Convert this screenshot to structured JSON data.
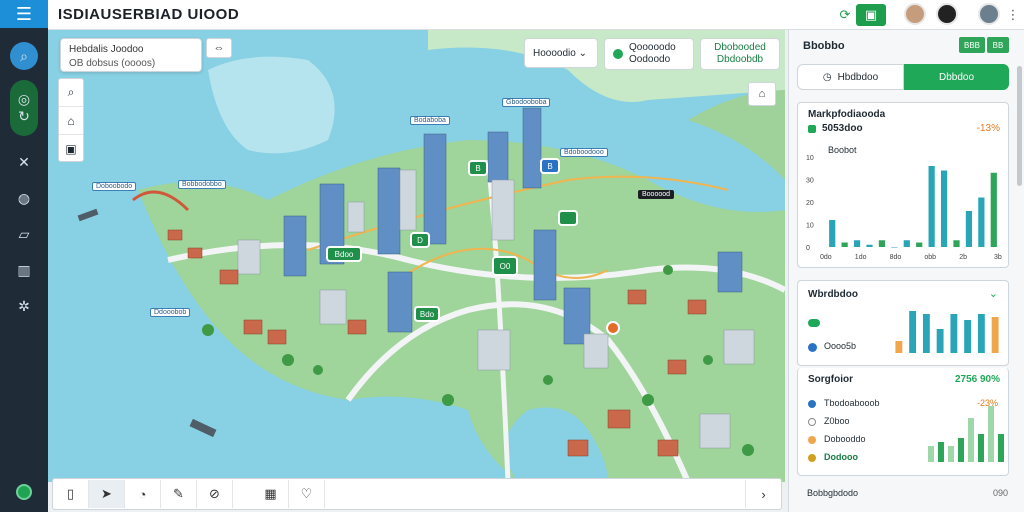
{
  "app": {
    "title": "ISDIAUSERBIAD UIOOD"
  },
  "topbar": {
    "notif_count": "0"
  },
  "map": {
    "location_card": {
      "line1": "Hebdalis Joodoo",
      "line2": "OB dobsus (oooos)"
    },
    "filter_1": "Hoooodio  ⌄",
    "filter_2_line1": "Qooooodo",
    "filter_2_line2": "Oodoodo",
    "filter_3_line1": "Dbobooded",
    "filter_3_line2": "Dbdoobdb",
    "labels": [
      "Gbodooboba",
      "Bodaboba",
      "Bdoboodooo",
      "Doboobodo",
      "Bobbodobbo",
      "Boooood",
      "Ddooobob"
    ],
    "pins": [
      "B",
      "B",
      "D",
      "O0",
      "Bdoo",
      "Bdo"
    ]
  },
  "bottom_bar": {
    "tools": [
      "pin",
      "navigate",
      "hand",
      "draw",
      "compass",
      "grid",
      "heart"
    ]
  },
  "panel": {
    "title": "Bbobbo",
    "badge_1": "BBB",
    "badge_2": "BB",
    "seg_left": "Hbdbdoo",
    "seg_right": "Dbbdoo",
    "card1": {
      "title": "Markpfodiaooda",
      "value": "5053doo",
      "delta": "-13%",
      "label": "Boobot",
      "tick_labels": [
        "10",
        "30",
        "20",
        "10",
        "0"
      ],
      "x_labels": [
        "0do",
        "1do",
        "8do",
        "obb",
        "2b",
        "3b"
      ]
    },
    "card2": {
      "title": "Wbrdbdoo",
      "legend": [
        "",
        "Oooo5b"
      ]
    },
    "card3": {
      "title": "Sorgfoior",
      "value": "2756 90%",
      "rows": [
        {
          "label": "Tbodoabooob",
          "value": "-23%"
        },
        {
          "label": "Z0boo",
          "value": ""
        },
        {
          "label": "Dobooddo",
          "value": ""
        },
        {
          "label": "Dodooo",
          "value": ""
        }
      ]
    },
    "footer": {
      "label": "Bobbgbdodo",
      "value": "090"
    },
    "colors": {
      "accent": "#1fa858",
      "teal": "#2aa5b8",
      "orange": "#f0a64a"
    }
  },
  "chart_data": [
    {
      "type": "bar",
      "title": "Boobot",
      "categories": [
        "1",
        "2",
        "3",
        "4",
        "5",
        "6",
        "7",
        "8",
        "9",
        "10",
        "11",
        "12",
        "13",
        "14"
      ],
      "values": [
        12,
        2,
        3,
        1,
        3,
        0,
        3,
        2,
        36,
        34,
        3,
        16,
        22,
        33
      ],
      "ylim": [
        0,
        40
      ]
    },
    {
      "type": "bar",
      "categories": [
        "1",
        "2",
        "3",
        "4",
        "5",
        "6",
        "7",
        "8"
      ],
      "series": [
        {
          "values": [
            4,
            14,
            13,
            8,
            13,
            11,
            13,
            12
          ]
        }
      ]
    },
    {
      "type": "bar",
      "categories": [
        "1",
        "2",
        "3",
        "4",
        "5",
        "6",
        "7",
        "8"
      ],
      "series": [
        {
          "values": [
            8,
            10,
            8,
            12,
            22,
            14,
            28,
            14
          ]
        }
      ]
    }
  ]
}
